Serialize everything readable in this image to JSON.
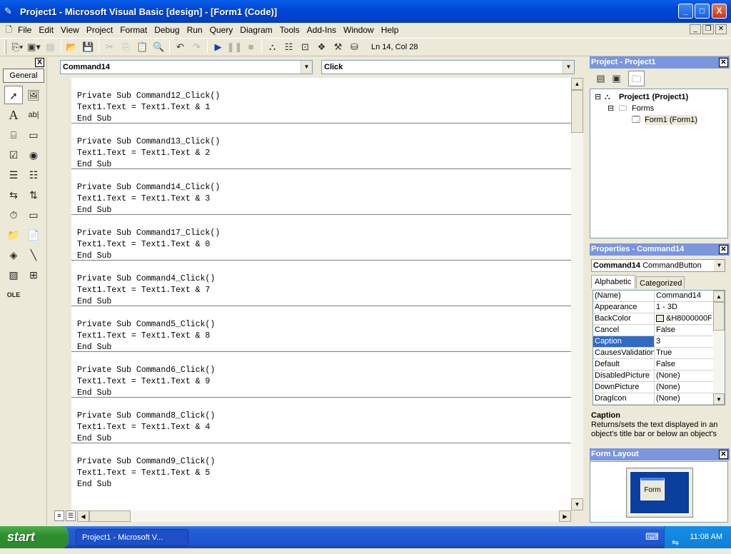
{
  "window": {
    "icon": "vb-app-icon",
    "title": "Project1 - Microsoft Visual Basic [design] - [Form1 (Code)]",
    "minimize": "_",
    "maximize": "□",
    "close": "X"
  },
  "menu": {
    "items": [
      "File",
      "Edit",
      "View",
      "Project",
      "Format",
      "Debug",
      "Run",
      "Query",
      "Diagram",
      "Tools",
      "Add-Ins",
      "Window",
      "Help"
    ]
  },
  "toolbar": {
    "status": "Ln 14, Col 28"
  },
  "toolbox": {
    "tab": "General",
    "close": "X"
  },
  "code": {
    "object_combo": "Command14",
    "proc_combo": "Click",
    "procs": [
      {
        "sub": "Private Sub Command12_Click()",
        "body": "Text1.Text = Text1.Text & 1",
        "end": "End Sub"
      },
      {
        "sub": "Private Sub Command13_Click()",
        "body": "Text1.Text = Text1.Text & 2",
        "end": "End Sub"
      },
      {
        "sub": "Private Sub Command14_Click()",
        "body": "Text1.Text = Text1.Text & 3",
        "end": "End Sub"
      },
      {
        "sub": "Private Sub Command17_Click()",
        "body": "Text1.Text = Text1.Text & 0",
        "end": "End Sub"
      },
      {
        "sub": "Private Sub Command4_Click()",
        "body": "Text1.Text = Text1.Text & 7",
        "end": "End Sub"
      },
      {
        "sub": "Private Sub Command5_Click()",
        "body": "Text1.Text = Text1.Text & 8",
        "end": "End Sub"
      },
      {
        "sub": "Private Sub Command6_Click()",
        "body": "Text1.Text = Text1.Text & 9",
        "end": "End Sub"
      },
      {
        "sub": "Private Sub Command8_Click()",
        "body": "Text1.Text = Text1.Text & 4",
        "end": "End Sub"
      },
      {
        "sub": "Private Sub Command9_Click()",
        "body": "Text1.Text = Text1.Text & 5",
        "end": "End Sub"
      }
    ]
  },
  "project": {
    "title": "Project - Project1",
    "root": "Project1 (Project1)",
    "folder": "Forms",
    "form": "Form1 (Form1)"
  },
  "properties": {
    "title": "Properties - Command14",
    "object_name": "Command14",
    "object_type": "CommandButton",
    "tab_alpha": "Alphabetic",
    "tab_cat": "Categorized",
    "rows": [
      {
        "name": "(Name)",
        "value": "Command14"
      },
      {
        "name": "Appearance",
        "value": "1 - 3D"
      },
      {
        "name": "BackColor",
        "value": "&H8000000F"
      },
      {
        "name": "Cancel",
        "value": "False"
      },
      {
        "name": "Caption",
        "value": "3"
      },
      {
        "name": "CausesValidation",
        "value": "True"
      },
      {
        "name": "Default",
        "value": "False"
      },
      {
        "name": "DisabledPicture",
        "value": "(None)"
      },
      {
        "name": "DownPicture",
        "value": "(None)"
      },
      {
        "name": "DragIcon",
        "value": "(None)"
      }
    ],
    "desc_title": "Caption",
    "desc_text": "Returns/sets the text displayed in an object's title bar or below an object's"
  },
  "layout": {
    "title": "Form Layout",
    "form_label": "Form"
  },
  "taskbar": {
    "start": "start",
    "task": "Project1 - Microsoft V...",
    "clock": "11:08 AM"
  }
}
